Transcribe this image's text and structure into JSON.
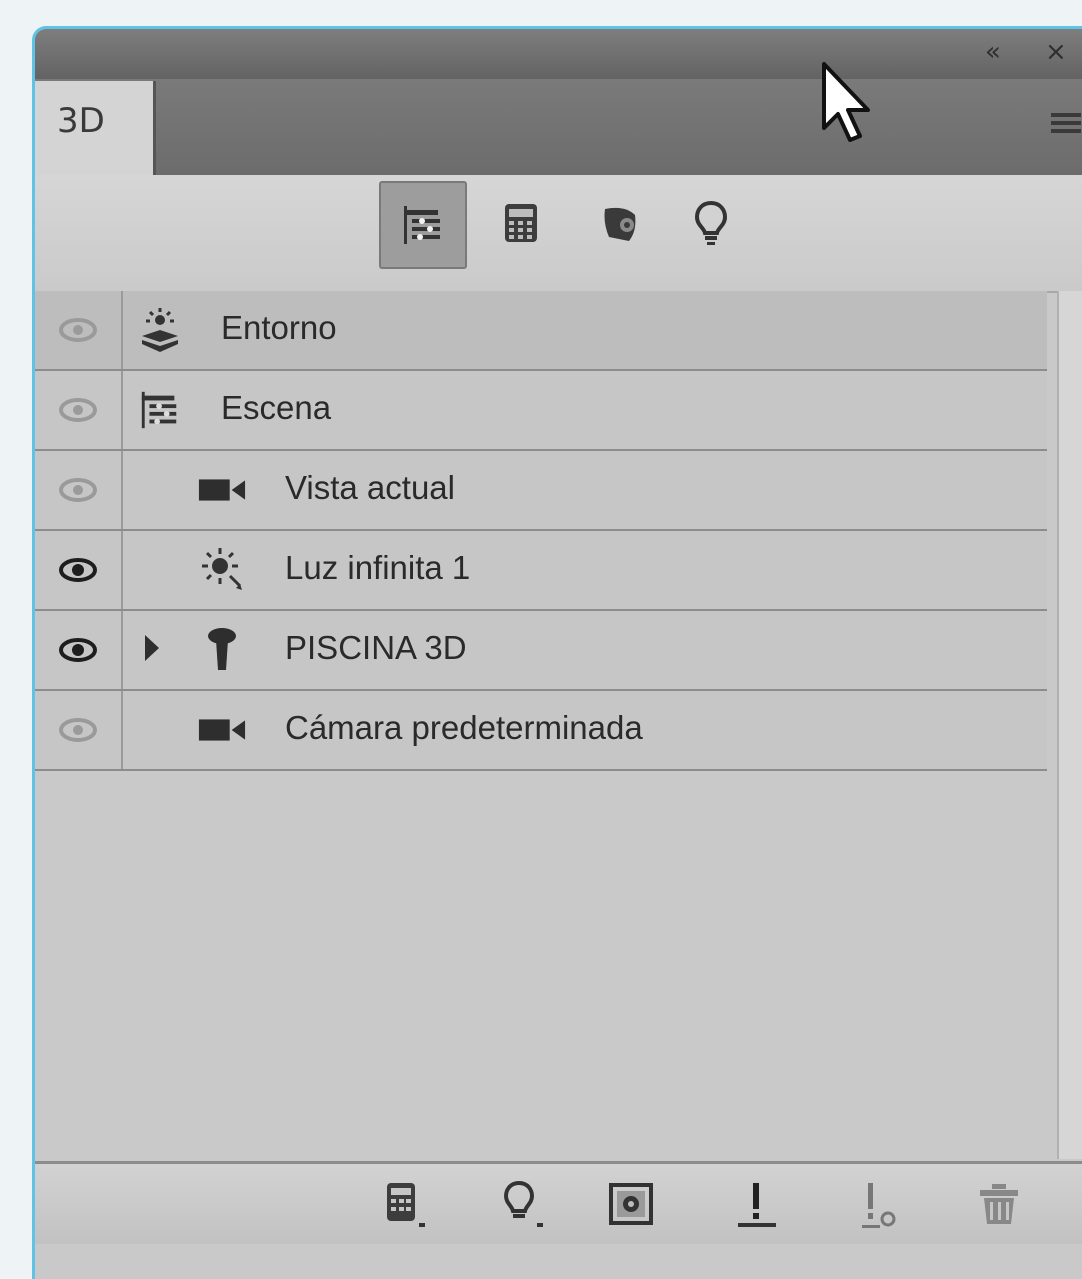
{
  "panel": {
    "tab_label": "3D"
  },
  "toolbar": {
    "buttons": [
      {
        "name": "scene-filter",
        "icon": "scene-hierarchy-icon",
        "active": true
      },
      {
        "name": "mesh-filter",
        "icon": "mesh-icon",
        "active": false
      },
      {
        "name": "material-filter",
        "icon": "material-icon",
        "active": false
      },
      {
        "name": "light-filter",
        "icon": "lightbulb-icon",
        "active": false
      }
    ]
  },
  "layers": [
    {
      "label": "Entorno",
      "icon": "environment-icon",
      "visible": false,
      "indent": 0,
      "expandable": false
    },
    {
      "label": "Escena",
      "icon": "scene-hierarchy-icon",
      "visible": false,
      "indent": 0,
      "expandable": false
    },
    {
      "label": "Vista actual",
      "icon": "camera-icon",
      "visible": false,
      "indent": 1,
      "expandable": false
    },
    {
      "label": "Luz infinita 1",
      "icon": "infinite-light-icon",
      "visible": true,
      "indent": 1,
      "expandable": false
    },
    {
      "label": "PISCINA 3D",
      "icon": "mesh-object-icon",
      "visible": true,
      "indent": 1,
      "expandable": true
    },
    {
      "label": "Cámara predeterminada",
      "icon": "camera-icon",
      "visible": false,
      "indent": 1,
      "expandable": false
    }
  ],
  "bottom_toolbar": {
    "buttons": [
      {
        "name": "new-mesh",
        "icon": "new-mesh-icon"
      },
      {
        "name": "new-light",
        "icon": "new-light-icon"
      },
      {
        "name": "render",
        "icon": "render-icon"
      },
      {
        "name": "drop-to-ground",
        "icon": "drop-to-ground-icon"
      },
      {
        "name": "ground-shadow",
        "icon": "ground-shadow-icon"
      },
      {
        "name": "delete",
        "icon": "trash-icon"
      }
    ]
  }
}
